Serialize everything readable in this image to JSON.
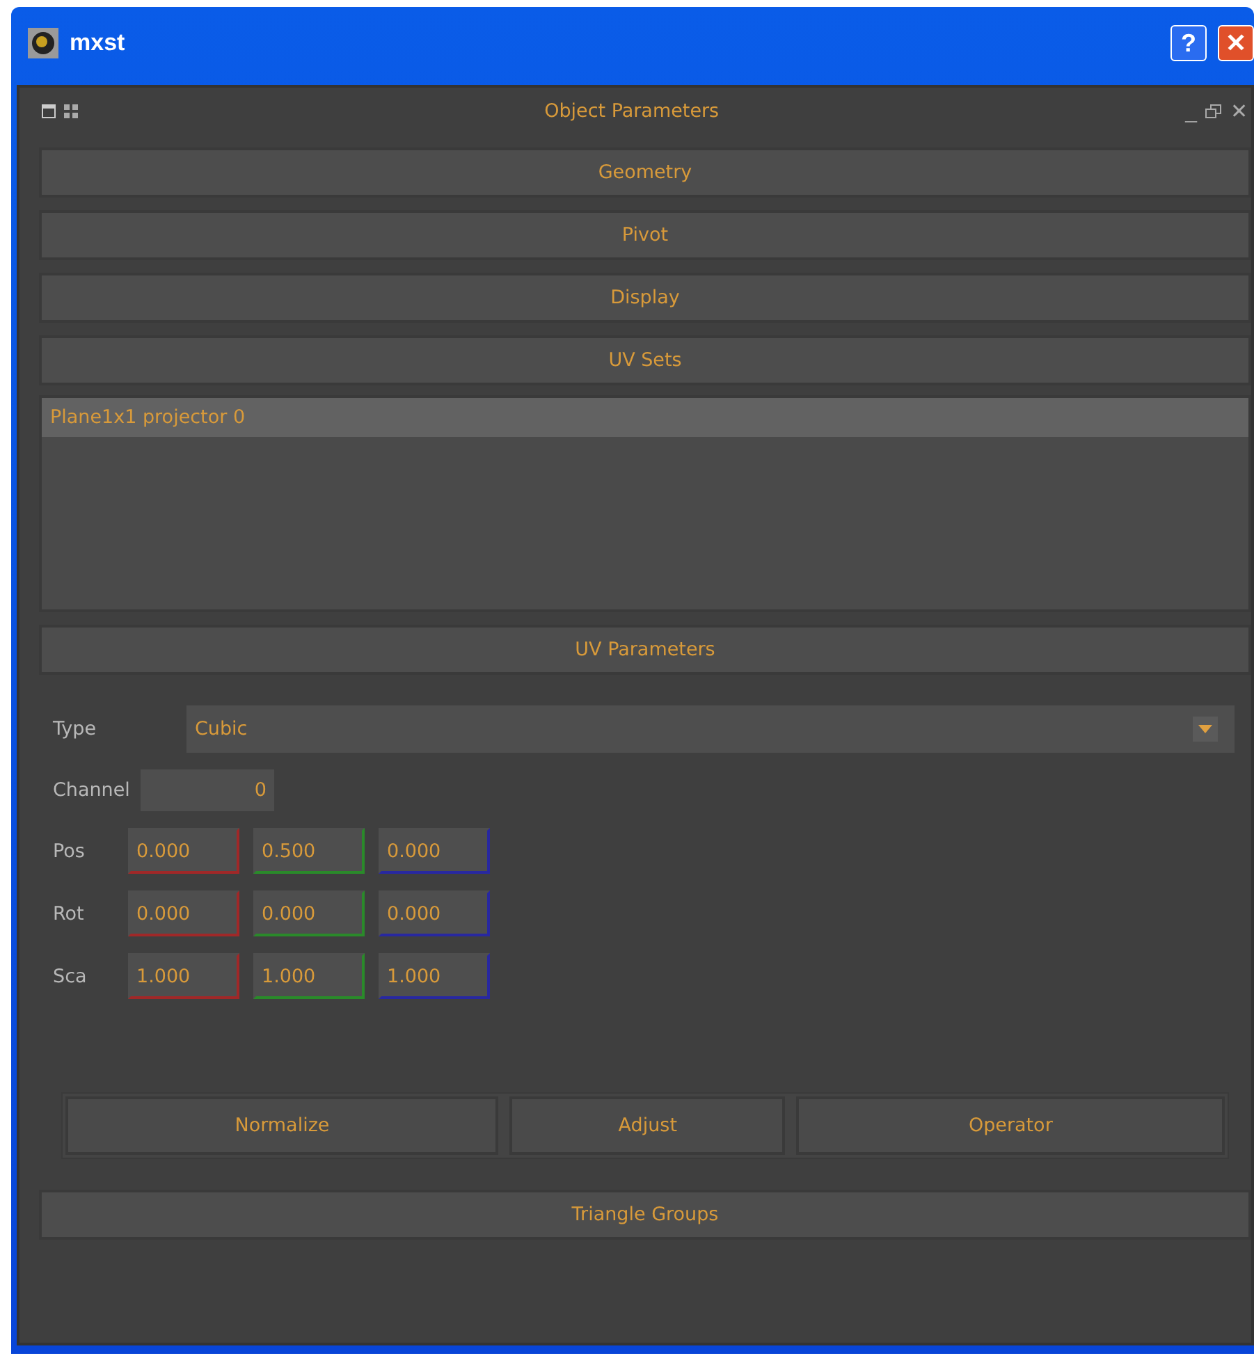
{
  "window": {
    "title": "mxst",
    "help_button": "?",
    "close_button": "✕"
  },
  "panel": {
    "title": "Object Parameters",
    "minimize": "_",
    "close": "✕"
  },
  "sections": [
    {
      "label": "Geometry"
    },
    {
      "label": "Pivot"
    },
    {
      "label": "Display"
    },
    {
      "label": "UV Sets"
    }
  ],
  "uv_sets": [
    {
      "label": "Plane1x1 projector 0",
      "selected": true
    }
  ],
  "uv_parameters": {
    "header": "UV Parameters",
    "type_label": "Type",
    "type_value": "Cubic",
    "channel_label": "Channel",
    "channel_value": "0",
    "vectors": [
      {
        "label": "Pos",
        "fields": [
          {
            "value": "0.000",
            "color": "#a02828"
          },
          {
            "value": "0.500",
            "color": "#2a8a2a"
          },
          {
            "value": "0.000",
            "color": "#2828a0"
          }
        ]
      },
      {
        "label": "Rot",
        "fields": [
          {
            "value": "0.000",
            "color": "#a02828"
          },
          {
            "value": "0.000",
            "color": "#2a8a2a"
          },
          {
            "value": "0.000",
            "color": "#2828a0"
          }
        ]
      },
      {
        "label": "Sca",
        "fields": [
          {
            "value": "1.000",
            "color": "#a02828"
          },
          {
            "value": "1.000",
            "color": "#2a8a2a"
          },
          {
            "value": "1.000",
            "color": "#2828a0"
          }
        ]
      }
    ],
    "buttons": [
      "Normalize",
      "Adjust",
      "Operator"
    ]
  },
  "footer_section": {
    "label": "Triangle Groups"
  }
}
